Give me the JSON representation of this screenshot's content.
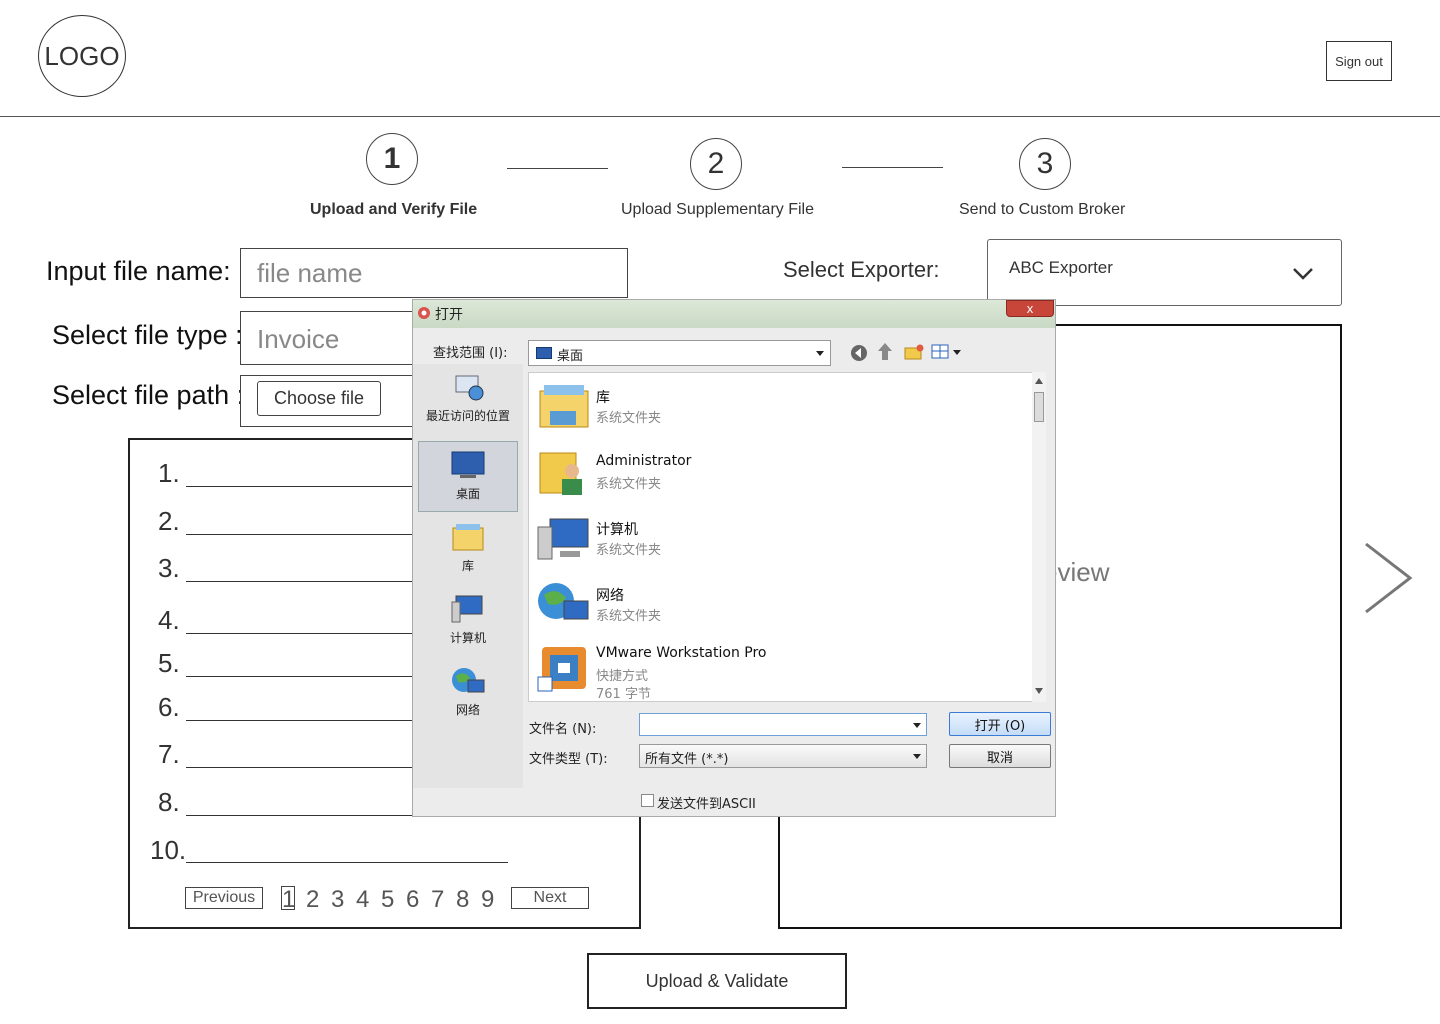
{
  "header": {
    "logo_text": "LOGO",
    "signout_label": "Sign out"
  },
  "steps": [
    {
      "number": "1",
      "label": "Upload and Verify File",
      "active": true
    },
    {
      "number": "2",
      "label": "Upload Supplementary File",
      "active": false
    },
    {
      "number": "3",
      "label": "Send to Custom Broker",
      "active": false
    }
  ],
  "form": {
    "file_name_label": "Input  file name:",
    "file_name_placeholder": "file name",
    "file_type_label": "Select file type  :",
    "file_type_value": "Invoice",
    "file_path_label": "Select file path  :",
    "choose_file_label": "Choose file"
  },
  "exporter": {
    "label": "Select Exporter:",
    "selected": "ABC Exporter"
  },
  "list": {
    "numbers": [
      "1.",
      "2.",
      "3.",
      "4.",
      "5.",
      "6.",
      "7.",
      "8.",
      "10."
    ],
    "previous_label": "Previous",
    "next_label": "Next",
    "pages": [
      "1",
      "2",
      "3",
      "4",
      "5",
      "6",
      "7",
      "8",
      "9"
    ],
    "current_page": "1"
  },
  "preview": {
    "text": "eview"
  },
  "upload_button_label": "Upload & Validate",
  "dialog": {
    "title": "打开",
    "close_label": "x",
    "look_in_label": "查找范围 (I):",
    "look_in_value": "桌面",
    "sidebar": [
      {
        "label": "最近访问的位置",
        "icon": "recent-places-icon"
      },
      {
        "label": "桌面",
        "icon": "desktop-icon",
        "selected": true
      },
      {
        "label": "库",
        "icon": "libraries-icon"
      },
      {
        "label": "计算机",
        "icon": "computer-icon"
      },
      {
        "label": "网络",
        "icon": "network-icon"
      }
    ],
    "files": [
      {
        "name": "库",
        "type": "系统文件夹",
        "icon": "libraries-folder-icon"
      },
      {
        "name": "Administrator",
        "type": "系统文件夹",
        "icon": "user-folder-icon"
      },
      {
        "name": "计算机",
        "type": "系统文件夹",
        "icon": "computer-icon"
      },
      {
        "name": "网络",
        "type": "系统文件夹",
        "icon": "network-icon"
      },
      {
        "name": "VMware Workstation Pro",
        "type": "快捷方式",
        "size": "761 字节",
        "icon": "vmware-shortcut-icon"
      }
    ],
    "file_name_label": "文件名 (N):",
    "file_name_value": "",
    "file_type_label": "文件类型 (T):",
    "file_type_value": "所有文件 (*.*)",
    "open_button": "打开 (O)",
    "cancel_button": "取消",
    "ascii_checkbox_label": "发送文件到ASCII"
  }
}
